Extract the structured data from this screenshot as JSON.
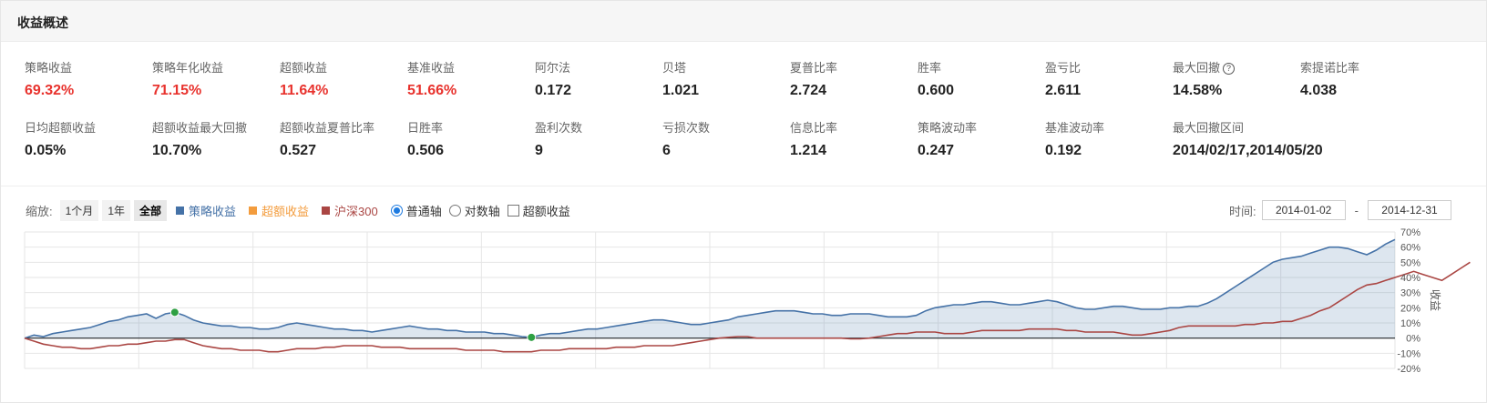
{
  "header": {
    "title": "收益概述"
  },
  "metrics_row1": [
    {
      "label": "策略收益",
      "value": "69.32%",
      "red": true
    },
    {
      "label": "策略年化收益",
      "value": "71.15%",
      "red": true
    },
    {
      "label": "超额收益",
      "value": "11.64%",
      "red": true
    },
    {
      "label": "基准收益",
      "value": "51.66%",
      "red": true
    },
    {
      "label": "阿尔法",
      "value": "0.172"
    },
    {
      "label": "贝塔",
      "value": "1.021"
    },
    {
      "label": "夏普比率",
      "value": "2.724"
    },
    {
      "label": "胜率",
      "value": "0.600"
    },
    {
      "label": "盈亏比",
      "value": "2.611"
    },
    {
      "label": "最大回撤",
      "value": "14.58%",
      "help": "?"
    },
    {
      "label": "索提诺比率",
      "value": "4.038"
    }
  ],
  "metrics_row2": [
    {
      "label": "日均超额收益",
      "value": "0.05%"
    },
    {
      "label": "超额收益最大回撤",
      "value": "10.70%"
    },
    {
      "label": "超额收益夏普比率",
      "value": "0.527"
    },
    {
      "label": "日胜率",
      "value": "0.506"
    },
    {
      "label": "盈利次数",
      "value": "9"
    },
    {
      "label": "亏损次数",
      "value": "6"
    },
    {
      "label": "信息比率",
      "value": "1.214"
    },
    {
      "label": "策略波动率",
      "value": "0.247"
    },
    {
      "label": "基准波动率",
      "value": "0.192"
    },
    {
      "label": "最大回撤区间",
      "value": "2014/02/17,2014/05/20"
    }
  ],
  "toolbar": {
    "zoom_label": "缩放:",
    "zoom_buttons": [
      {
        "label": "1个月",
        "active": false
      },
      {
        "label": "1年",
        "active": false
      },
      {
        "label": "全部",
        "active": true
      }
    ],
    "legend": [
      {
        "label": "策略收益",
        "color": "#4572a7"
      },
      {
        "label": "超额收益",
        "color": "#f39c3d"
      },
      {
        "label": "沪深300",
        "color": "#aa4643"
      }
    ],
    "axis_options": [
      {
        "label": "普通轴",
        "type": "radio",
        "checked": true
      },
      {
        "label": "对数轴",
        "type": "radio",
        "checked": false
      },
      {
        "label": "超额收益",
        "type": "checkbox",
        "checked": false
      }
    ]
  },
  "daterange": {
    "label": "时间:",
    "start": "2014-01-02",
    "end": "2014-12-31",
    "separator": "-"
  },
  "colors": {
    "strategy": "#4572a7",
    "benchmark": "#aa4643",
    "excess": "#f39c3d",
    "marker": "#2ea043",
    "up": "#e8322d"
  },
  "chart_data": {
    "type": "line",
    "ylabel": "收益",
    "ylim": [
      -20,
      70
    ],
    "yticks": [
      -20,
      -10,
      0,
      10,
      20,
      30,
      40,
      50,
      60,
      70
    ],
    "ytick_labels": [
      "-20%",
      "-10%",
      "0%",
      "10%",
      "20%",
      "30%",
      "40%",
      "50%",
      "60%",
      "70%"
    ],
    "grid": true,
    "series": [
      {
        "name": "策略收益",
        "color": "#4572a7",
        "values": [
          0,
          2,
          1,
          3,
          4,
          5,
          6,
          7,
          9,
          11,
          12,
          14,
          15,
          16,
          13,
          16,
          17,
          15,
          12,
          10,
          9,
          8,
          8,
          7,
          7,
          6,
          6,
          7,
          9,
          10,
          9,
          8,
          7,
          6,
          6,
          5,
          5,
          4,
          5,
          6,
          7,
          8,
          7,
          6,
          6,
          5,
          5,
          4,
          4,
          4,
          3,
          3,
          2,
          1,
          0.5,
          2,
          3,
          3,
          4,
          5,
          6,
          6,
          7,
          8,
          9,
          10,
          11,
          12,
          12,
          11,
          10,
          9,
          9,
          10,
          11,
          12,
          14,
          15,
          16,
          17,
          18,
          18,
          18,
          17,
          16,
          16,
          15,
          15,
          16,
          16,
          16,
          15,
          14,
          14,
          14,
          15,
          18,
          20,
          21,
          22,
          22,
          23,
          24,
          24,
          23,
          22,
          22,
          23,
          24,
          25,
          24,
          22,
          20,
          19,
          19,
          20,
          21,
          21,
          20,
          19,
          19,
          19,
          20,
          20,
          21,
          21,
          23,
          26,
          30,
          34,
          38,
          42,
          46,
          50,
          52,
          53,
          54,
          56,
          58,
          60,
          60,
          59,
          57,
          55,
          58,
          62,
          65
        ]
      },
      {
        "name": "沪深300",
        "color": "#aa4643",
        "values": [
          0,
          -2,
          -4,
          -5,
          -6,
          -6,
          -7,
          -7,
          -6,
          -5,
          -5,
          -4,
          -4,
          -3,
          -2,
          -2,
          -1,
          -1,
          -3,
          -5,
          -6,
          -7,
          -7,
          -8,
          -8,
          -8,
          -9,
          -9,
          -8,
          -7,
          -7,
          -7,
          -6,
          -6,
          -5,
          -5,
          -5,
          -5,
          -6,
          -6,
          -6,
          -7,
          -7,
          -7,
          -7,
          -7,
          -7,
          -8,
          -8,
          -8,
          -8,
          -9,
          -9,
          -9,
          -9,
          -8,
          -8,
          -8,
          -7,
          -7,
          -7,
          -7,
          -7,
          -6,
          -6,
          -6,
          -5,
          -5,
          -5,
          -5,
          -4,
          -3,
          -2,
          -1,
          0,
          0.5,
          1,
          1,
          0,
          0,
          0,
          0,
          0,
          0,
          0,
          0,
          0,
          0,
          -0.5,
          -0.5,
          0,
          1,
          2,
          3,
          3,
          4,
          4,
          4,
          3,
          3,
          3,
          4,
          5,
          5,
          5,
          5,
          5,
          6,
          6,
          6,
          6,
          5,
          5,
          4,
          4,
          4,
          4,
          3,
          2,
          2,
          3,
          4,
          5,
          7,
          8,
          8,
          8,
          8,
          8,
          8,
          9,
          9,
          10,
          10,
          11,
          11,
          13,
          15,
          18,
          20,
          24,
          28,
          32,
          35,
          36,
          38,
          40,
          42,
          44,
          42,
          40,
          38,
          42,
          46,
          50
        ]
      }
    ]
  }
}
